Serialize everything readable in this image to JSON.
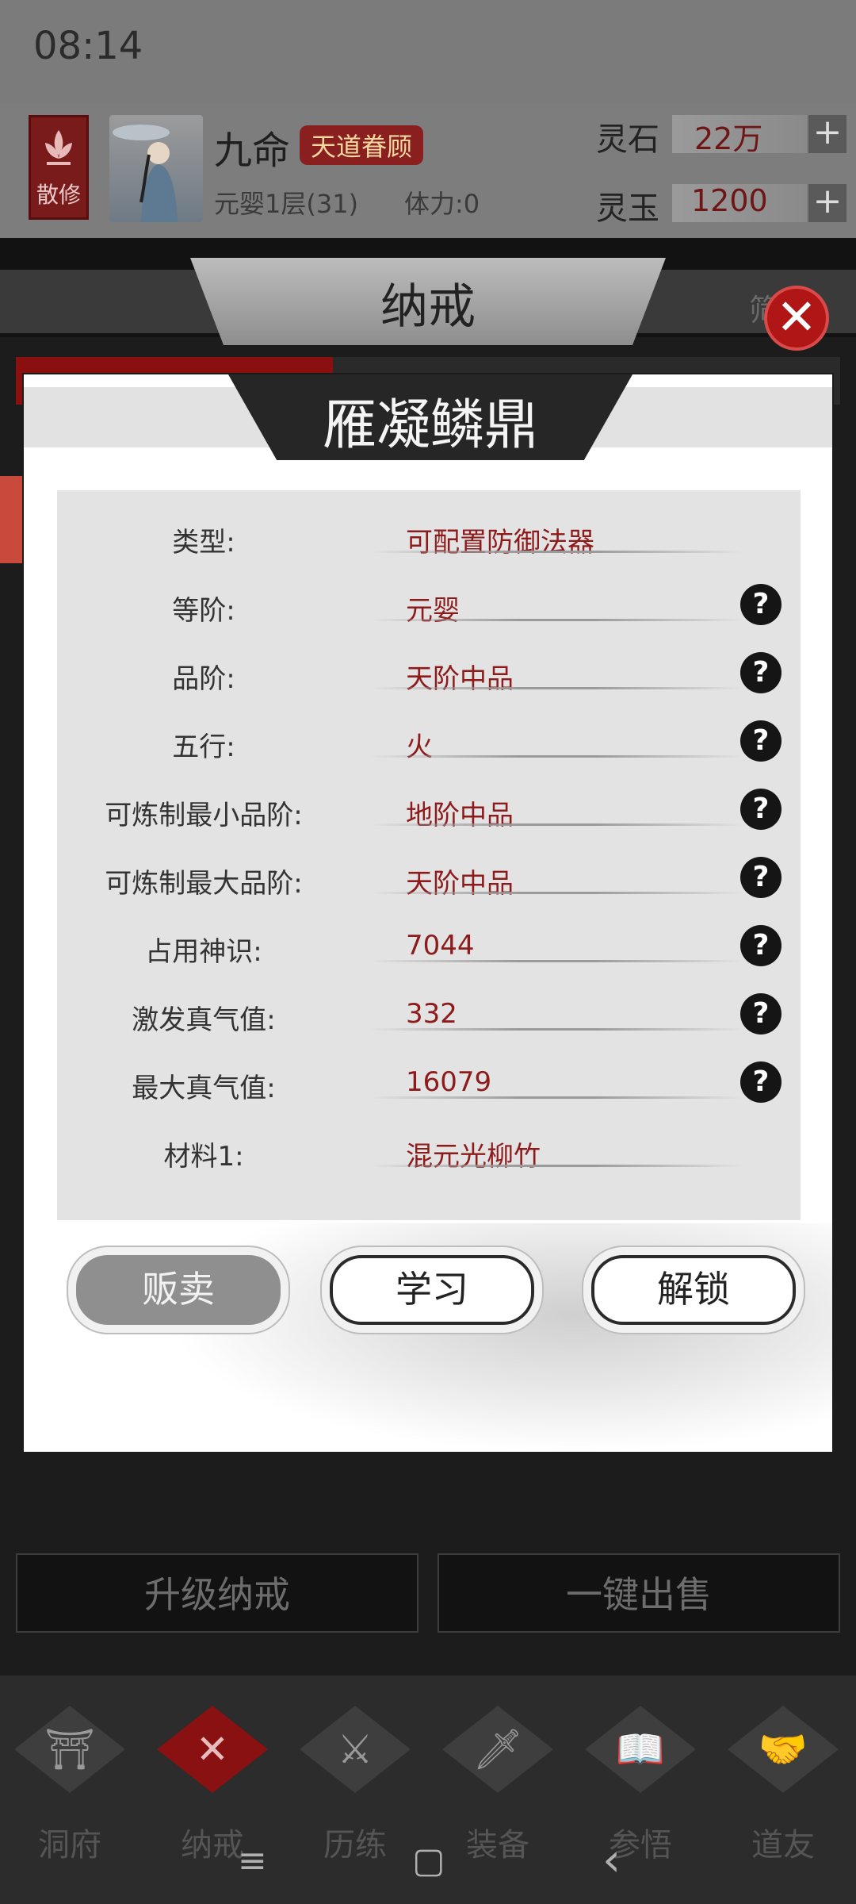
{
  "status": {
    "time": "08:14"
  },
  "player": {
    "sect": "散修",
    "name": "九命",
    "title": "天道眷顾",
    "realm": "元婴1层(31)",
    "stamina": "体力:0"
  },
  "currencies": [
    {
      "label": "灵石",
      "value": "22万"
    },
    {
      "label": "灵玉",
      "value": "1200"
    }
  ],
  "screen": {
    "tab_title": "纳戒",
    "filter_label": "筛"
  },
  "modal": {
    "title": "雁凝鳞鼎",
    "rows": [
      {
        "key": "类型:",
        "value": "可配置防御法器",
        "has_help": false
      },
      {
        "key": "等阶:",
        "value": "元婴",
        "has_help": true
      },
      {
        "key": "品阶:",
        "value": "天阶中品",
        "has_help": true
      },
      {
        "key": "五行:",
        "value": "火",
        "has_help": true
      },
      {
        "key": "可炼制最小品阶:",
        "value": "地阶中品",
        "has_help": true
      },
      {
        "key": "可炼制最大品阶:",
        "value": "天阶中品",
        "has_help": true
      },
      {
        "key": "占用神识:",
        "value": "7044",
        "has_help": true
      },
      {
        "key": "激发真气值:",
        "value": "332",
        "has_help": true
      },
      {
        "key": "最大真气值:",
        "value": "16079",
        "has_help": true
      },
      {
        "key": "材料1:",
        "value": "混元光柳竹",
        "has_help": false
      }
    ],
    "help_glyph": "?",
    "buttons": {
      "sell": "贩卖",
      "learn": "学习",
      "unlock": "解锁"
    },
    "close_glyph": "✕"
  },
  "bottom_buttons": {
    "upgrade": "升级纳戒",
    "quick_sell": "一键出售"
  },
  "nav": [
    {
      "label": "洞府",
      "icon": "gate-icon",
      "glyph": "⛩"
    },
    {
      "label": "纳戒",
      "icon": "ring-icon",
      "glyph": "✕",
      "active": true
    },
    {
      "label": "历练",
      "icon": "crossed-swords-icon",
      "glyph": "⚔"
    },
    {
      "label": "装备",
      "icon": "dagger-icon",
      "glyph": "🗡"
    },
    {
      "label": "参悟",
      "icon": "book-icon",
      "glyph": "📖"
    },
    {
      "label": "道友",
      "icon": "handshake-icon",
      "glyph": "🤝"
    }
  ],
  "system_nav": {
    "menu": "≡",
    "home": "▢",
    "back": "‹"
  },
  "colors": {
    "accent_red": "#8a1111",
    "value_red": "#8e1b1b"
  }
}
